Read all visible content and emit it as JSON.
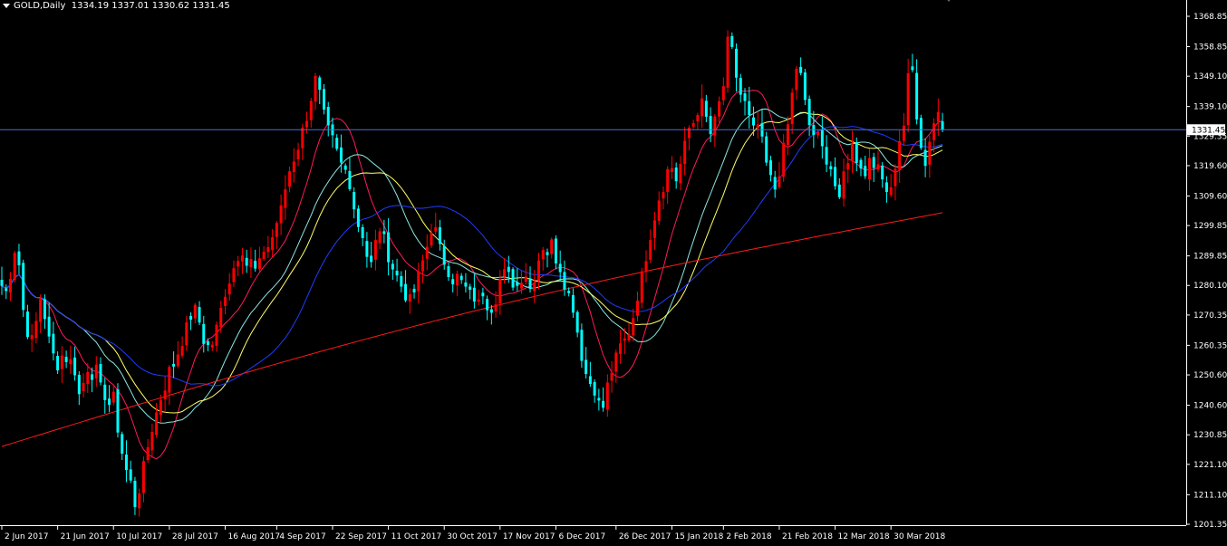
{
  "header": {
    "symbol_timeframe": "GOLD,Daily",
    "ohlc": "1334.19 1337.01 1330.62 1331.45"
  },
  "icons": {
    "dropdown": "triangle-down-icon",
    "window_marker": "triangle-down-icon"
  },
  "colors": {
    "background": "#000000",
    "axis": "#ffffff",
    "bull_candle": "#ff0000",
    "bear_candle": "#00ffff",
    "current_price_line": "#4a6fd0",
    "ma_fast": "#ff1a5a",
    "ma_cyan": "#8be8e0",
    "ma_yellow": "#ffff66",
    "ma_blue": "#1f3cff",
    "ma_slow": "#ff1a1a"
  },
  "chart_data": {
    "type": "candlestick",
    "symbol": "GOLD",
    "timeframe": "Daily",
    "ylim": [
      1201.35,
      1373.0
    ],
    "y_ticks": [
      "1368.85",
      "1358.85",
      "1349.10",
      "1339.10",
      "1329.35",
      "1319.60",
      "1309.60",
      "1299.85",
      "1289.85",
      "1280.10",
      "1270.35",
      "1260.35",
      "1250.60",
      "1240.60",
      "1230.85",
      "1221.10",
      "1211.10",
      "1201.35"
    ],
    "x_ticks": [
      "2 Jun 2017",
      "21 Jun 2017",
      "10 Jul 2017",
      "28 Jul 2017",
      "16 Aug 2017",
      "4 Sep 2017",
      "22 Sep 2017",
      "11 Oct 2017",
      "30 Oct 2017",
      "17 Nov 2017",
      "6 Dec 2017",
      "26 Dec 2017",
      "15 Jan 2018",
      "2 Feb 2018",
      "21 Feb 2018",
      "12 Mar 2018",
      "30 Mar 2018"
    ],
    "current_price": "1331.45",
    "close_path": [
      [
        0,
        1280
      ],
      [
        1,
        1278
      ],
      [
        2,
        1284
      ],
      [
        3,
        1292
      ],
      [
        4,
        1287
      ],
      [
        5,
        1272
      ],
      [
        6,
        1265
      ],
      [
        7,
        1262
      ],
      [
        8,
        1268
      ],
      [
        9,
        1276
      ],
      [
        10,
        1270
      ],
      [
        11,
        1262
      ],
      [
        12,
        1257
      ],
      [
        13,
        1254
      ],
      [
        14,
        1257
      ],
      [
        15,
        1256
      ],
      [
        16,
        1255
      ],
      [
        17,
        1252
      ],
      [
        18,
        1244
      ],
      [
        19,
        1248
      ],
      [
        20,
        1253
      ],
      [
        21,
        1251
      ],
      [
        22,
        1252
      ],
      [
        23,
        1246
      ],
      [
        24,
        1244
      ],
      [
        25,
        1241
      ],
      [
        26,
        1243
      ],
      [
        27,
        1233
      ],
      [
        28,
        1225
      ],
      [
        29,
        1219
      ],
      [
        30,
        1215
      ],
      [
        31,
        1208
      ],
      [
        32,
        1213
      ],
      [
        33,
        1220
      ],
      [
        34,
        1227
      ],
      [
        35,
        1233
      ],
      [
        36,
        1238
      ],
      [
        37,
        1243
      ],
      [
        38,
        1247
      ],
      [
        39,
        1252
      ],
      [
        40,
        1254
      ],
      [
        41,
        1258
      ],
      [
        42,
        1262
      ],
      [
        43,
        1266
      ],
      [
        44,
        1270
      ],
      [
        45,
        1272
      ],
      [
        46,
        1268
      ],
      [
        47,
        1262
      ],
      [
        48,
        1260
      ],
      [
        49,
        1261
      ],
      [
        50,
        1266
      ],
      [
        51,
        1272
      ],
      [
        52,
        1278
      ],
      [
        53,
        1282
      ],
      [
        54,
        1286
      ],
      [
        55,
        1290
      ],
      [
        56,
        1292
      ],
      [
        57,
        1287
      ],
      [
        58,
        1288
      ],
      [
        59,
        1285
      ],
      [
        60,
        1287
      ],
      [
        61,
        1292
      ],
      [
        62,
        1293
      ],
      [
        63,
        1296
      ],
      [
        64,
        1301
      ],
      [
        65,
        1305
      ],
      [
        66,
        1312
      ],
      [
        67,
        1318
      ],
      [
        68,
        1322
      ],
      [
        69,
        1326
      ],
      [
        70,
        1331
      ],
      [
        71,
        1336
      ],
      [
        72,
        1342
      ],
      [
        73,
        1348
      ],
      [
        74,
        1343
      ],
      [
        75,
        1336
      ],
      [
        76,
        1331
      ],
      [
        77,
        1328
      ],
      [
        78,
        1324
      ],
      [
        79,
        1320
      ],
      [
        80,
        1318
      ],
      [
        81,
        1314
      ],
      [
        82,
        1306
      ],
      [
        83,
        1300
      ],
      [
        84,
        1297
      ],
      [
        85,
        1290
      ],
      [
        86,
        1287
      ],
      [
        87,
        1294
      ],
      [
        88,
        1299
      ],
      [
        89,
        1295
      ],
      [
        90,
        1290
      ],
      [
        91,
        1286
      ],
      [
        92,
        1283
      ],
      [
        93,
        1280
      ],
      [
        94,
        1277
      ],
      [
        95,
        1275
      ],
      [
        96,
        1278
      ],
      [
        97,
        1283
      ],
      [
        98,
        1288
      ],
      [
        99,
        1293
      ],
      [
        100,
        1299
      ],
      [
        101,
        1298
      ],
      [
        102,
        1292
      ],
      [
        103,
        1288
      ],
      [
        104,
        1285
      ],
      [
        105,
        1282
      ],
      [
        106,
        1283
      ],
      [
        107,
        1281
      ],
      [
        108,
        1279
      ],
      [
        109,
        1277
      ],
      [
        110,
        1276
      ],
      [
        111,
        1274
      ],
      [
        112,
        1278
      ],
      [
        113,
        1274
      ],
      [
        114,
        1273
      ],
      [
        115,
        1276
      ],
      [
        116,
        1282
      ],
      [
        117,
        1284
      ],
      [
        118,
        1283
      ],
      [
        119,
        1281
      ],
      [
        120,
        1280
      ],
      [
        121,
        1283
      ],
      [
        122,
        1284
      ],
      [
        123,
        1279
      ],
      [
        124,
        1283
      ],
      [
        125,
        1289
      ],
      [
        126,
        1293
      ],
      [
        127,
        1291
      ],
      [
        128,
        1294
      ],
      [
        129,
        1289
      ],
      [
        130,
        1286
      ],
      [
        131,
        1281
      ],
      [
        132,
        1277
      ],
      [
        133,
        1273
      ],
      [
        134,
        1265
      ],
      [
        135,
        1257
      ],
      [
        136,
        1251
      ],
      [
        137,
        1248
      ],
      [
        138,
        1246
      ],
      [
        139,
        1241
      ],
      [
        140,
        1240
      ],
      [
        141,
        1247
      ],
      [
        142,
        1252
      ],
      [
        143,
        1256
      ],
      [
        144,
        1260
      ],
      [
        145,
        1262
      ],
      [
        146,
        1265
      ],
      [
        147,
        1270
      ],
      [
        148,
        1277
      ],
      [
        149,
        1283
      ],
      [
        150,
        1290
      ],
      [
        151,
        1297
      ],
      [
        152,
        1303
      ],
      [
        153,
        1309
      ],
      [
        154,
        1313
      ],
      [
        155,
        1318
      ],
      [
        156,
        1319
      ],
      [
        157,
        1315
      ],
      [
        158,
        1320
      ],
      [
        159,
        1326
      ],
      [
        160,
        1332
      ],
      [
        161,
        1334
      ],
      [
        162,
        1338
      ],
      [
        163,
        1340
      ],
      [
        164,
        1335
      ],
      [
        165,
        1330
      ],
      [
        166,
        1334
      ],
      [
        167,
        1340
      ],
      [
        168,
        1346
      ],
      [
        169,
        1360
      ],
      [
        170,
        1357
      ],
      [
        171,
        1349
      ],
      [
        172,
        1343
      ],
      [
        173,
        1340
      ],
      [
        174,
        1335
      ],
      [
        175,
        1331
      ],
      [
        176,
        1333
      ],
      [
        177,
        1327
      ],
      [
        178,
        1320
      ],
      [
        179,
        1315
      ],
      [
        180,
        1312
      ],
      [
        181,
        1318
      ],
      [
        182,
        1325
      ],
      [
        183,
        1333
      ],
      [
        184,
        1343
      ],
      [
        185,
        1352
      ],
      [
        186,
        1349
      ],
      [
        187,
        1340
      ],
      [
        188,
        1333
      ],
      [
        189,
        1330
      ],
      [
        190,
        1329
      ],
      [
        191,
        1325
      ],
      [
        192,
        1322
      ],
      [
        193,
        1319
      ],
      [
        194,
        1313
      ],
      [
        195,
        1307
      ],
      [
        196,
        1317
      ],
      [
        197,
        1322
      ],
      [
        198,
        1326
      ],
      [
        199,
        1322
      ],
      [
        200,
        1320
      ],
      [
        201,
        1316
      ],
      [
        202,
        1323
      ],
      [
        203,
        1321
      ],
      [
        204,
        1318
      ],
      [
        205,
        1315
      ],
      [
        206,
        1313
      ],
      [
        207,
        1313
      ],
      [
        208,
        1320
      ],
      [
        209,
        1327
      ],
      [
        210,
        1334
      ],
      [
        211,
        1349
      ],
      [
        212,
        1352
      ],
      [
        213,
        1333
      ],
      [
        214,
        1325
      ],
      [
        215,
        1320
      ],
      [
        216,
        1326
      ],
      [
        217,
        1335
      ],
      [
        218,
        1338
      ],
      [
        219,
        1331
      ]
    ]
  }
}
